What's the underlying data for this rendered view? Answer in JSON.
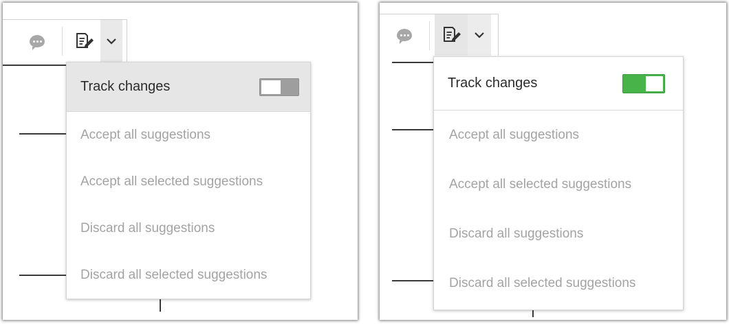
{
  "left_panel": {
    "menu": {
      "track_changes_label": "Track changes",
      "track_changes_enabled": false,
      "items": [
        {
          "label": "Accept all suggestions"
        },
        {
          "label": "Accept all selected suggestions"
        },
        {
          "label": "Discard all suggestions"
        },
        {
          "label": "Discard all selected suggestions"
        }
      ]
    }
  },
  "right_panel": {
    "menu": {
      "track_changes_label": "Track changes",
      "track_changes_enabled": true,
      "items": [
        {
          "label": "Accept all suggestions"
        },
        {
          "label": "Accept all selected suggestions"
        },
        {
          "label": "Discard all suggestions"
        },
        {
          "label": "Discard all selected suggestions"
        }
      ]
    }
  },
  "colors": {
    "toggle_on": "#47b349",
    "toggle_off": "#9e9e9e",
    "disabled_text": "#a3a3a3",
    "active_text": "#2c2c2c"
  },
  "icons": {
    "comment": "comment-icon",
    "track_changes": "track-changes-icon",
    "dropdown": "chevron-down-icon"
  }
}
